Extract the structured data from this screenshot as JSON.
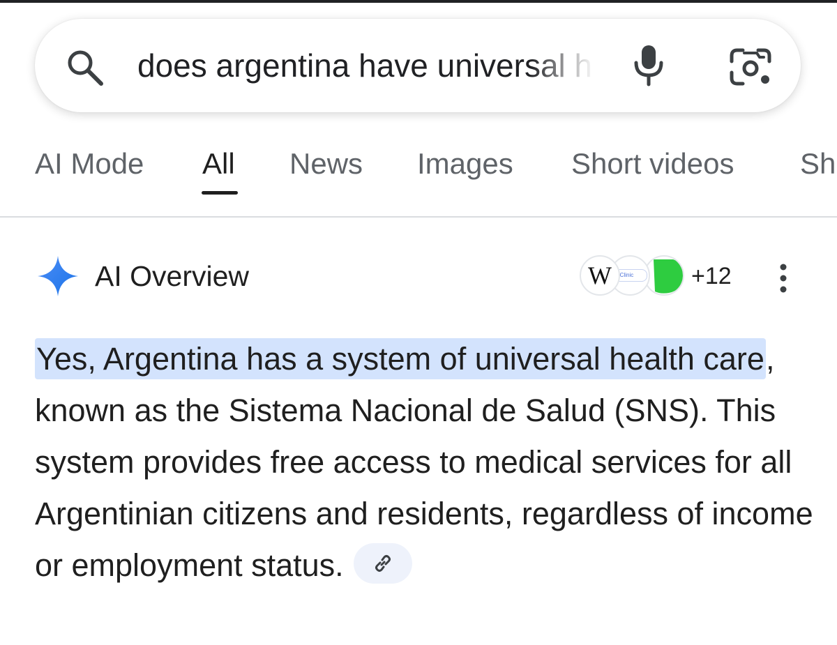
{
  "search": {
    "query": "does argentina have universal health care",
    "icons": {
      "left": "search-icon",
      "voice": "mic-icon",
      "camera": "lens-icon"
    }
  },
  "tabs": [
    {
      "label": "AI Mode",
      "active": false
    },
    {
      "label": "All",
      "active": true
    },
    {
      "label": "News",
      "active": false
    },
    {
      "label": "Images",
      "active": false
    },
    {
      "label": "Short videos",
      "active": false
    },
    {
      "label": "Sh",
      "active": false
    }
  ],
  "ai_overview": {
    "title": "AI Overview",
    "sources": [
      {
        "icon": "wikipedia-icon",
        "label": "W"
      },
      {
        "icon": "clinic-logo-icon",
        "label": "d Clinic"
      },
      {
        "icon": "green-leaf-icon"
      }
    ],
    "sources_more": "+12",
    "answer_highlight": "Yes, Argentina has a system of universal health care",
    "answer_rest": ", known as the Sistema Nacional de Salud (SNS). This system provides free access to medical services for all Argentinian citizens and residents, regardless of income or employment status."
  },
  "colors": {
    "accent_blue": "#4285f4",
    "highlight": "#d3e3fd",
    "text_primary": "#1f1f1f",
    "text_secondary": "#5f6368"
  }
}
